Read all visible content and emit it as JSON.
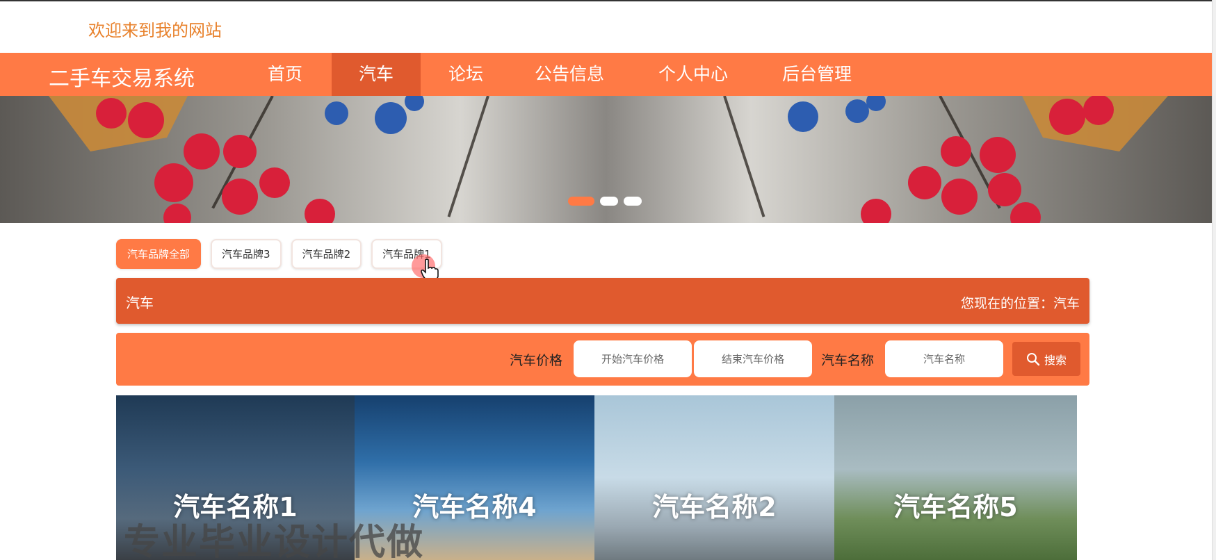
{
  "header": {
    "welcome": "欢迎来到我的网站"
  },
  "nav": {
    "brand": "二手车交易系统",
    "items": [
      {
        "label": "首页"
      },
      {
        "label": "汽车"
      },
      {
        "label": "论坛"
      },
      {
        "label": "公告信息"
      },
      {
        "label": "个人中心"
      },
      {
        "label": "后台管理"
      }
    ],
    "active_index": 1
  },
  "colors": {
    "primary": "#ff7a45",
    "primary_dark": "#e05a2e",
    "welcome_text": "#e8822d"
  },
  "filters": [
    {
      "label": "汽车品牌全部"
    },
    {
      "label": "汽车品牌3"
    },
    {
      "label": "汽车品牌2"
    },
    {
      "label": "汽车品牌1"
    }
  ],
  "titlebar": {
    "title": "汽车",
    "location": "您现在的位置：汽车"
  },
  "search": {
    "price_label": "汽车价格",
    "price_start_placeholder": "开始汽车价格",
    "price_end_placeholder": "结束汽车价格",
    "name_label": "汽车名称",
    "name_placeholder": "汽车名称",
    "button_label": "搜索",
    "button_icon": "search-icon"
  },
  "cars": [
    {
      "name": "汽车名称1"
    },
    {
      "name": "汽车名称4"
    },
    {
      "name": "汽车名称2"
    },
    {
      "name": "汽车名称5"
    }
  ],
  "watermark": "专业毕业设计代做"
}
